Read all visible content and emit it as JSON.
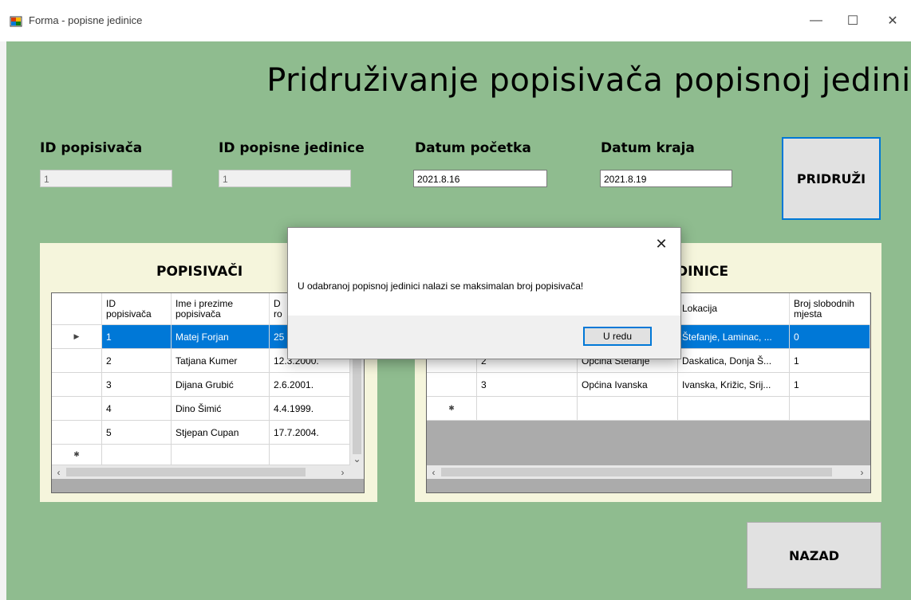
{
  "window": {
    "title": "Forma - popisne jedinice",
    "minimize": "—",
    "maximize": "☐",
    "close": "✕"
  },
  "heading": "Pridruživanje popisivača popisnoj jedinici",
  "fields": {
    "id_popisivaca": {
      "label": "ID popisivača",
      "value": "1"
    },
    "id_jedinice": {
      "label": "ID popisne jedinice",
      "value": "1"
    },
    "datum_pocetka": {
      "label": "Datum početka",
      "value": "2021.8.16"
    },
    "datum_kraja": {
      "label": "Datum kraja",
      "value": "2021.8.19"
    }
  },
  "buttons": {
    "pridruzi": "PRIDRUŽI",
    "nazad": "NAZAD"
  },
  "left_panel": {
    "title": "POPISIVAČI",
    "columns": [
      "ID\npopisivača",
      "Ime i prezime\npopisivača",
      "D\nro"
    ],
    "rows": [
      [
        "1",
        "Matej Forjan",
        "25"
      ],
      [
        "2",
        "Tatjana Kumer",
        "12.3.2000."
      ],
      [
        "3",
        "Dijana Grubić",
        "2.6.2001."
      ],
      [
        "4",
        "Dino Šimić",
        "4.4.1999."
      ],
      [
        "5",
        "Stjepan Cupan",
        "17.7.2004."
      ]
    ],
    "new_row_marker": "✱",
    "current_row_marker": "▶"
  },
  "right_panel": {
    "title": "DINICE",
    "columns": [
      "",
      "",
      "Lokacija",
      "Broj slobodnih\nmjesta"
    ],
    "rows": [
      [
        "",
        "",
        "Štefanje, Laminac, ...",
        "0"
      ],
      [
        "2",
        "Općina Štefanje",
        "Daskatica, Donja Š...",
        "1"
      ],
      [
        "3",
        "Općina Ivanska",
        "Ivanska, Križic, Srij...",
        "1"
      ]
    ],
    "new_row_marker": "✱"
  },
  "dialog": {
    "message": "U odabranoj popisnoj jedinici nalazi se maksimalan broj popisivača!",
    "ok_label": "U redu",
    "close": "✕"
  },
  "colors": {
    "form_bg": "#8fbc8f",
    "panel_bg": "#f5f5dc",
    "selection": "#0078d7"
  }
}
